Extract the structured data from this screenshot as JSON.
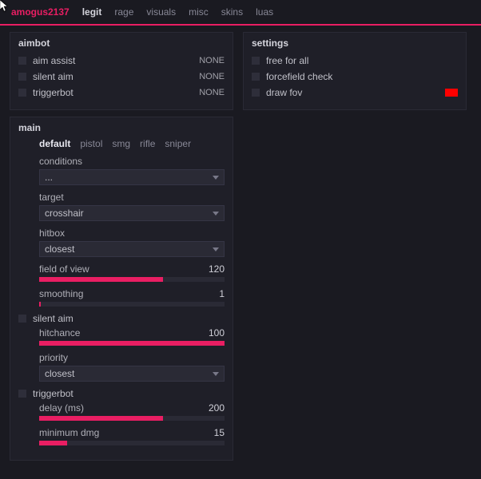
{
  "cursor": true,
  "nav": {
    "user": "amogus2137",
    "items": [
      "legit",
      "rage",
      "visuals",
      "misc",
      "skins",
      "luas"
    ],
    "active": "legit"
  },
  "aimbot": {
    "title": "aimbot",
    "items": [
      {
        "label": "aim assist",
        "bind": "NONE"
      },
      {
        "label": "silent aim",
        "bind": "NONE"
      },
      {
        "label": "triggerbot",
        "bind": "NONE"
      }
    ]
  },
  "settings": {
    "title": "settings",
    "items": [
      {
        "label": "free for all"
      },
      {
        "label": "forcefield check"
      },
      {
        "label": "draw fov",
        "color": "#ff0000"
      }
    ]
  },
  "main": {
    "title": "main",
    "weapon_tabs": [
      "default",
      "pistol",
      "smg",
      "rifle",
      "sniper"
    ],
    "active_tab": "default",
    "conditions": {
      "label": "conditions",
      "value": "..."
    },
    "target": {
      "label": "target",
      "value": "crosshair"
    },
    "hitbox": {
      "label": "hitbox",
      "value": "closest"
    },
    "fov": {
      "label": "field of view",
      "value": 120,
      "max": 180
    },
    "smoothing": {
      "label": "smoothing",
      "value": 1,
      "max": 100
    },
    "silent": {
      "header": "silent aim",
      "hitchance": {
        "label": "hitchance",
        "value": 100,
        "max": 100
      },
      "priority": {
        "label": "priority",
        "value": "closest"
      }
    },
    "trigger": {
      "header": "triggerbot",
      "delay": {
        "label": "delay (ms)",
        "value": 200,
        "max": 300
      },
      "mindmg": {
        "label": "minimum dmg",
        "value": 15,
        "max": 100
      }
    }
  }
}
